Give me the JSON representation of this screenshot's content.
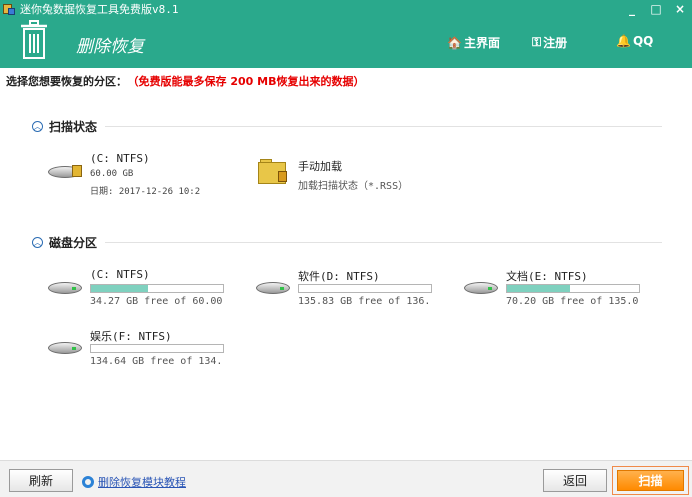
{
  "window": {
    "title": "迷你兔数据恢复工具免费版v8.1",
    "controls": {
      "minimize": "_",
      "maximize": "□",
      "close": "×"
    }
  },
  "header": {
    "title": "删除恢复",
    "nav": [
      {
        "icon": "home-icon",
        "glyph": "🏠",
        "label": "主界面"
      },
      {
        "icon": "key-icon",
        "glyph": "⚿",
        "label": "注册"
      },
      {
        "icon": "qq-icon",
        "glyph": "🔔",
        "label": "QQ"
      }
    ]
  },
  "prompt": {
    "label": "选择您想要恢复的分区：",
    "notice": "（免费版能最多保存 200 MB恢复出来的数据）"
  },
  "scan_status": {
    "heading": "扫描状态",
    "items": [
      {
        "name": "(C: NTFS)",
        "size": "60.00 GB",
        "date": "日期: 2017-12-26 10:2"
      },
      {
        "name": "手动加载",
        "desc": "加载扫描状态（*.RSS）"
      }
    ]
  },
  "partitions": {
    "heading": "磁盘分区",
    "items": [
      {
        "name": "(C: NTFS)",
        "free": "34.27 GB free of 60.00",
        "used_fraction": 0.43
      },
      {
        "name": "软件(D: NTFS)",
        "free": "135.83 GB free of 136.",
        "used_fraction": 0.0
      },
      {
        "name": "文档(E: NTFS)",
        "free": "70.20 GB free of 135.0",
        "used_fraction": 0.48
      },
      {
        "name": "娱乐(F: NTFS)",
        "free": "134.64 GB free of 134.",
        "used_fraction": 0.0
      }
    ]
  },
  "footer": {
    "refresh": "刷新",
    "help_link": "删除恢复模块教程",
    "back": "返回",
    "scan": "扫描"
  },
  "colors": {
    "accent": "#2aa98c",
    "bar_fill": "#7fd1bf",
    "notice": "#e60000",
    "scan_button": "#ff8a00"
  }
}
